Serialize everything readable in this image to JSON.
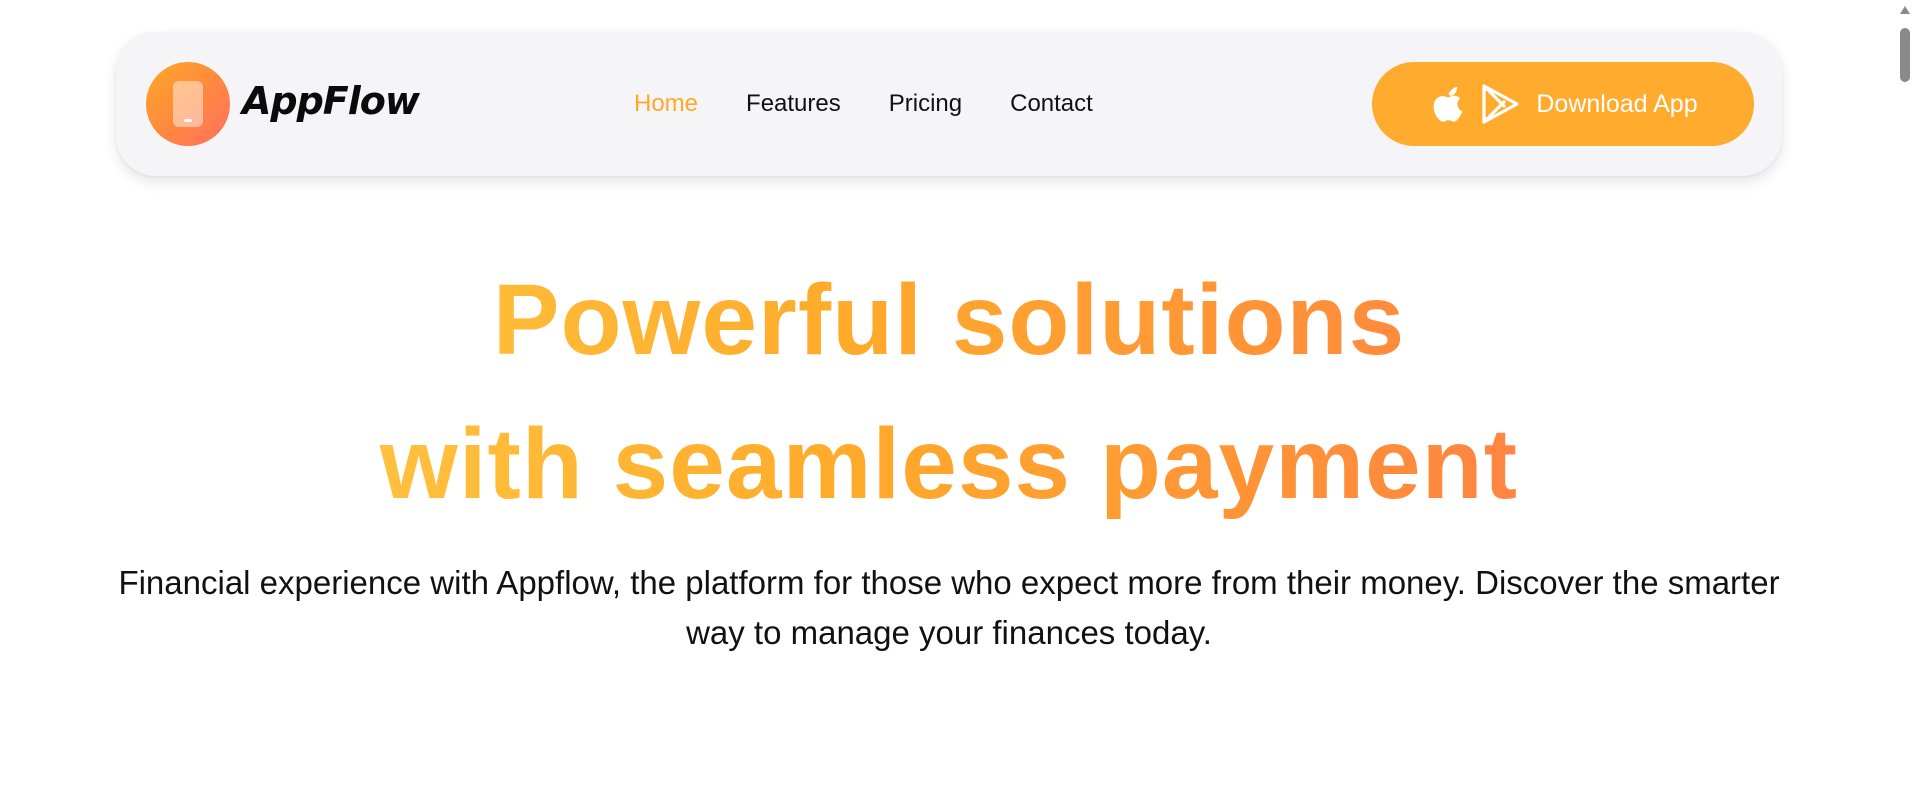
{
  "brand": {
    "name": "AppFlow",
    "logo_icon": "phone-icon"
  },
  "nav": {
    "items": [
      {
        "label": "Home",
        "active": true
      },
      {
        "label": "Features",
        "active": false
      },
      {
        "label": "Pricing",
        "active": false
      },
      {
        "label": "Contact",
        "active": false
      }
    ]
  },
  "download_button": {
    "label": "Download App",
    "icons": [
      "apple-icon",
      "google-play-icon"
    ]
  },
  "hero": {
    "title_line1": "Powerful solutions",
    "title_line2": "with seamless payment",
    "subtitle": "Financial experience with Appflow, the platform for those who expect more from their money. Discover the smarter way to manage your finances today."
  },
  "colors": {
    "accent": "#ffab2e",
    "active_nav": "#ffa928",
    "gradient_start": "#ffd24d",
    "gradient_mid": "#ffaa2a",
    "gradient_end": "#ff6f61",
    "navbar_bg": "#f5f5f7",
    "text": "#111111"
  }
}
